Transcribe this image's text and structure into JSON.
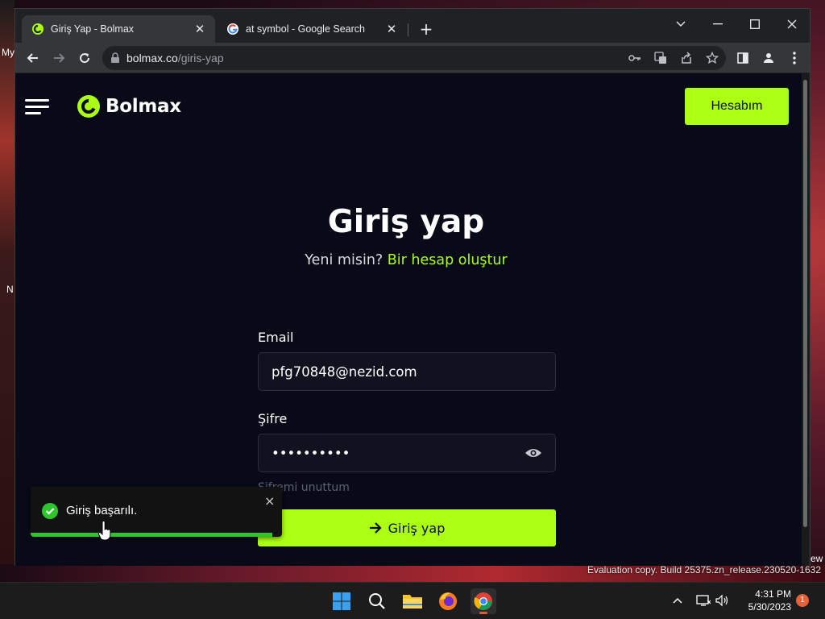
{
  "desktop": {
    "left_texts": [
      "My",
      "N"
    ],
    "right_text": "ew",
    "watermark": "Evaluation copy. Build 25375.zn_release.230520-1632"
  },
  "tabs": [
    {
      "title": "Giriş Yap - Bolmax",
      "active": true,
      "icon": "bolmax-favicon"
    },
    {
      "title": "at symbol - Google Search",
      "active": false,
      "icon": "google-favicon"
    }
  ],
  "address_bar": {
    "host": "bolmax.co",
    "path": "/giris-yap"
  },
  "header": {
    "brand": "Bolmax",
    "account_button": "Hesabım"
  },
  "login": {
    "title": "Giriş yap",
    "subtitle_prefix": "Yeni misin?",
    "register_link": "Bir hesap oluştur",
    "email_label": "Email",
    "email_value": "pfg70848@nezid.com",
    "password_label": "Şifre",
    "password_value": "••••••••••",
    "forgot_link": "Şifremi unuttum",
    "submit_label": "Giriş yap"
  },
  "toast": {
    "message": "Giriş başarılı.",
    "progress": 0.96,
    "close": "×"
  },
  "taskbar": {
    "time": "4:31 PM",
    "date": "5/30/2023",
    "notification_count": "1"
  },
  "colors": {
    "accent": "#aaff14",
    "page_bg": "#080a18",
    "toast_bar": "#2ec42e"
  }
}
